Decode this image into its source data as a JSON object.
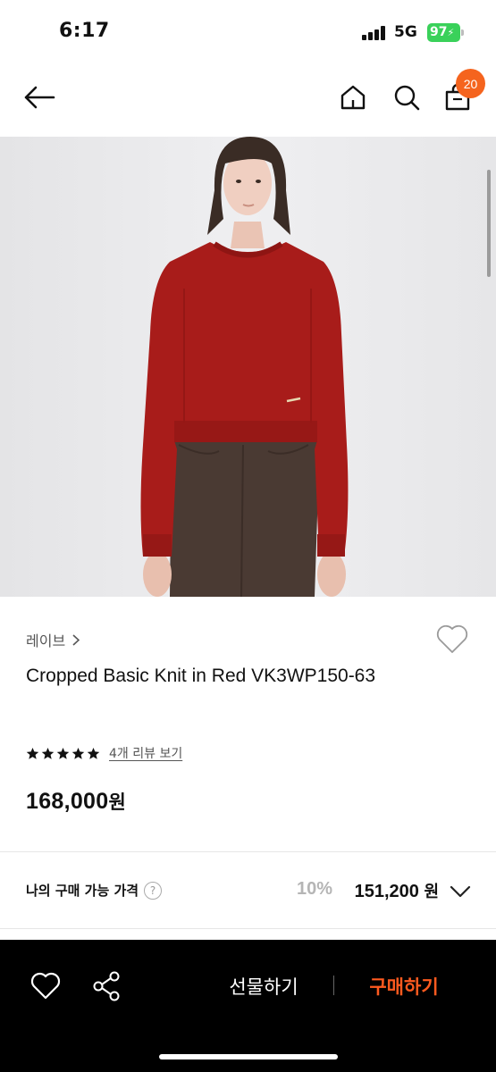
{
  "status_bar": {
    "time": "6:17",
    "network": "5G",
    "battery": "97"
  },
  "nav": {
    "cart_count": "20",
    "icons": [
      "back-arrow-icon",
      "home-icon",
      "search-icon",
      "shopping-bag-icon"
    ]
  },
  "gallery": {
    "progress": 0.25
  },
  "product": {
    "brand": "레이브",
    "title": "Cropped Basic Knit in Red VK3WP150-63",
    "rating_stars": 5,
    "review_link": "4개 리뷰 보기",
    "price": "168,000",
    "price_unit": "원"
  },
  "my_price": {
    "label": "나의 구매 가능 가격",
    "help": "?",
    "discount": "10%",
    "price": "151,200",
    "unit": "원"
  },
  "bottom_bar": {
    "gift_label": "선물하기",
    "buy_label": "구매하기"
  },
  "colors": {
    "accent": "#f5641e",
    "buy": "#ff5a1f",
    "sweater": "#a81c1a"
  }
}
